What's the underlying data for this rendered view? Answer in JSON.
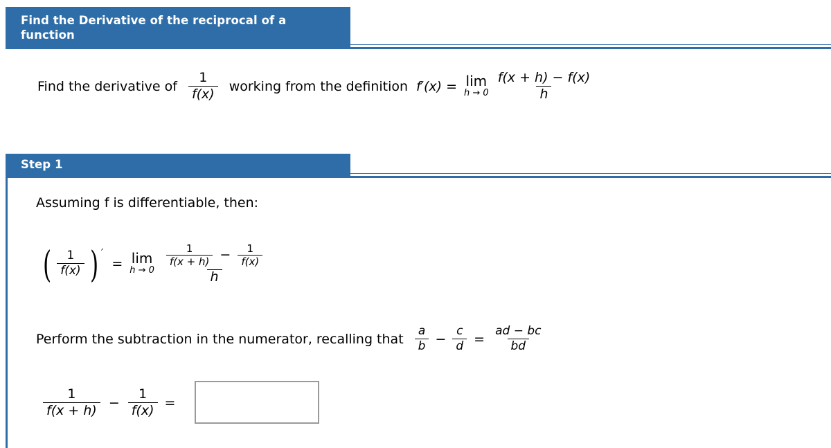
{
  "colors": {
    "header_blue": "#2e6da8",
    "rule_blue": "#2e6da8",
    "answer_box_border": "#9a9a9a",
    "text": "#000000",
    "page_background": "#ffffff"
  },
  "title_bar": {
    "text": "Find the Derivative of the reciprocal of a\nfunction"
  },
  "question": {
    "lead_text": "Find the derivative of",
    "reciprocal_fraction": {
      "numerator": "1",
      "denominator": "f(x)"
    },
    "middle_text": "working from the definition",
    "definition": {
      "lhs": "f′(x)",
      "equals": "=",
      "limit_operator": "lim",
      "limit_subscript": "h → 0",
      "numerator": "f(x + h) − f(x)",
      "denominator": "h"
    }
  },
  "step1_bar": {
    "text": "Step 1"
  },
  "step1": {
    "assumption_text": "Assuming f is differentiable, then:",
    "derivative_equation": {
      "lhs_open_paren": "(",
      "lhs_fraction": {
        "numerator": "1",
        "denominator": "f(x)"
      },
      "lhs_close_paren": ")",
      "prime": "′",
      "equals": "=",
      "limit_operator": "lim",
      "limit_subscript": "h → 0",
      "numerator_first_fraction": {
        "numerator": "1",
        "denominator": "f(x + h)"
      },
      "numerator_minus": "−",
      "numerator_second_fraction": {
        "numerator": "1",
        "denominator": "f(x)"
      },
      "denominator": "h"
    },
    "instruction_text": "Perform the subtraction in the numerator, recalling that",
    "subtraction_rule": {
      "first_fraction": {
        "numerator": "a",
        "denominator": "b"
      },
      "minus": "−",
      "second_fraction": {
        "numerator": "c",
        "denominator": "d"
      },
      "equals": "=",
      "result_fraction": {
        "numerator": "ad − bc",
        "denominator": "bd"
      }
    },
    "answer_equation": {
      "first_fraction": {
        "numerator": "1",
        "denominator": "f(x + h)"
      },
      "minus": "−",
      "second_fraction": {
        "numerator": "1",
        "denominator": "f(x)"
      },
      "equals": "=",
      "answer_value": "",
      "answer_placeholder": ""
    }
  }
}
